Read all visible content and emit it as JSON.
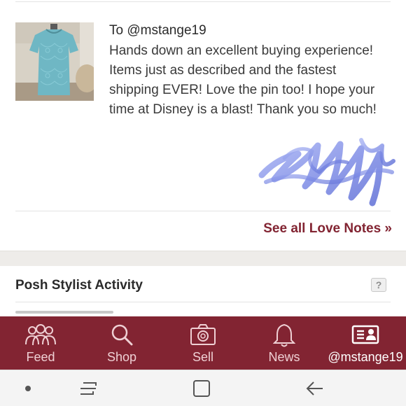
{
  "love_note": {
    "recipient": "To @mstange19",
    "message": "Hands down an excellent buying experience! Items just as described and the fastest shipping EVER! Love the pin too! I hope your time at Disney is a blast! Thank you so much!",
    "thumbnail_icon": "product-photo-lace-top",
    "signature_icon": "handwritten-signature"
  },
  "see_all_link": "See all Love Notes »",
  "stylist": {
    "title": "Posh Stylist Activity",
    "help_label": "?"
  },
  "tab_bar": {
    "background_color": "#822432",
    "tabs": [
      {
        "label": "Feed",
        "icon": "people-icon",
        "active": false
      },
      {
        "label": "Shop",
        "icon": "search-icon",
        "active": false
      },
      {
        "label": "Sell",
        "icon": "camera-icon",
        "active": false
      },
      {
        "label": "News",
        "icon": "bell-icon",
        "active": false
      },
      {
        "label": "@mstange19",
        "icon": "profile-card-icon",
        "active": true
      }
    ]
  },
  "android_nav": {
    "buttons": [
      "dot-icon",
      "recents-icon",
      "home-icon",
      "back-icon"
    ]
  },
  "colors": {
    "brand": "#822432",
    "link": "#822432"
  }
}
